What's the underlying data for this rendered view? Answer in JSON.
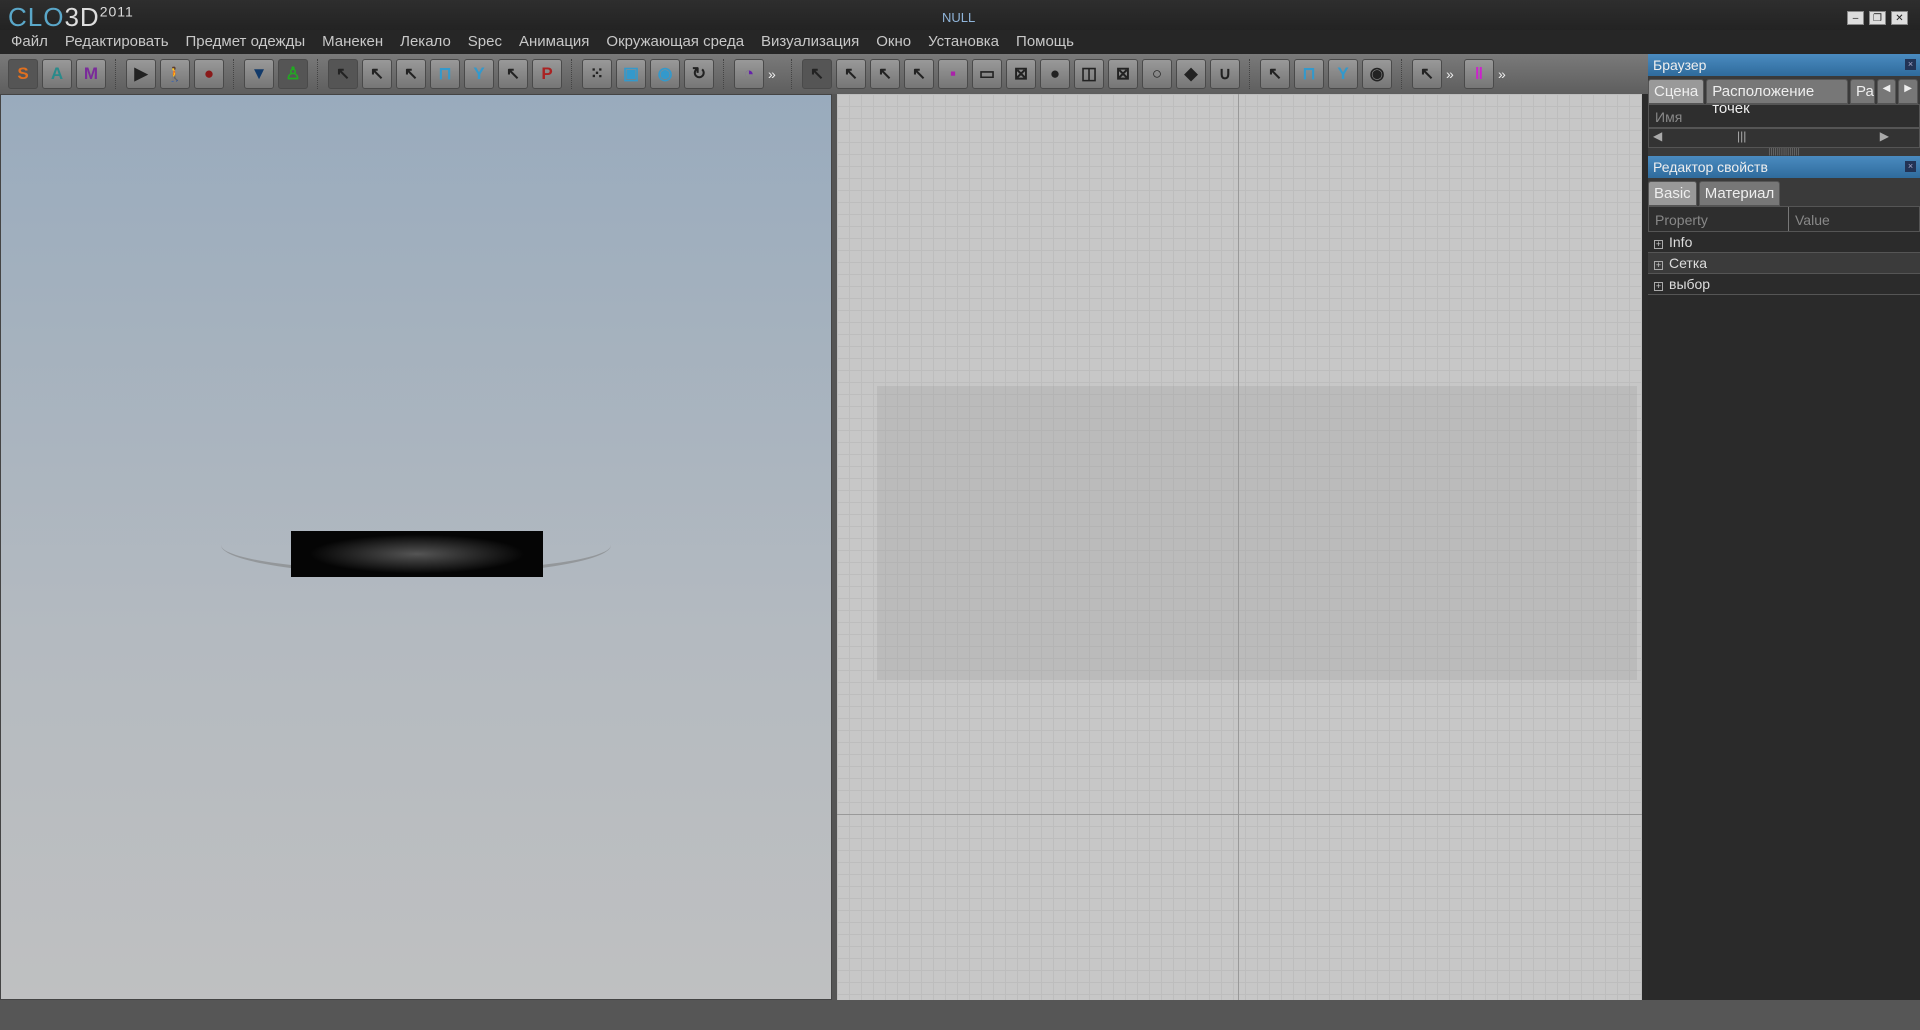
{
  "app": {
    "logo": "CLO",
    "logo_3d": "3D",
    "logo_year": "2011",
    "title": "NULL"
  },
  "window": {
    "minimize": "–",
    "restore": "❐",
    "close": "✕"
  },
  "menu": [
    "Файл",
    "Редактировать",
    "Предмет одежды",
    "Манекен",
    "Лекало",
    "Spec",
    "Анимация",
    "Окружающая среда",
    "Визуализация",
    "Окно",
    "Установка",
    "Помощь"
  ],
  "toolbar": {
    "s": "S",
    "a": "A",
    "m": "M",
    "play": "▶",
    "walk": "🚶",
    "record": "●",
    "more": "»"
  },
  "browser": {
    "title": "Браузер",
    "tabs": [
      "Сцена",
      "Расположение точек",
      "Ра"
    ],
    "column": "Имя",
    "tab_prev": "◀",
    "tab_next": "▶"
  },
  "property_editor": {
    "title": "Редактор свойств",
    "tabs": [
      "Basic",
      "Материал"
    ],
    "columns": [
      "Property",
      "Value"
    ],
    "rows": [
      "Info",
      "Сетка",
      "выбор"
    ]
  },
  "colors": {
    "accent": "#2f6b9c",
    "logo": "#5aa7c9"
  }
}
